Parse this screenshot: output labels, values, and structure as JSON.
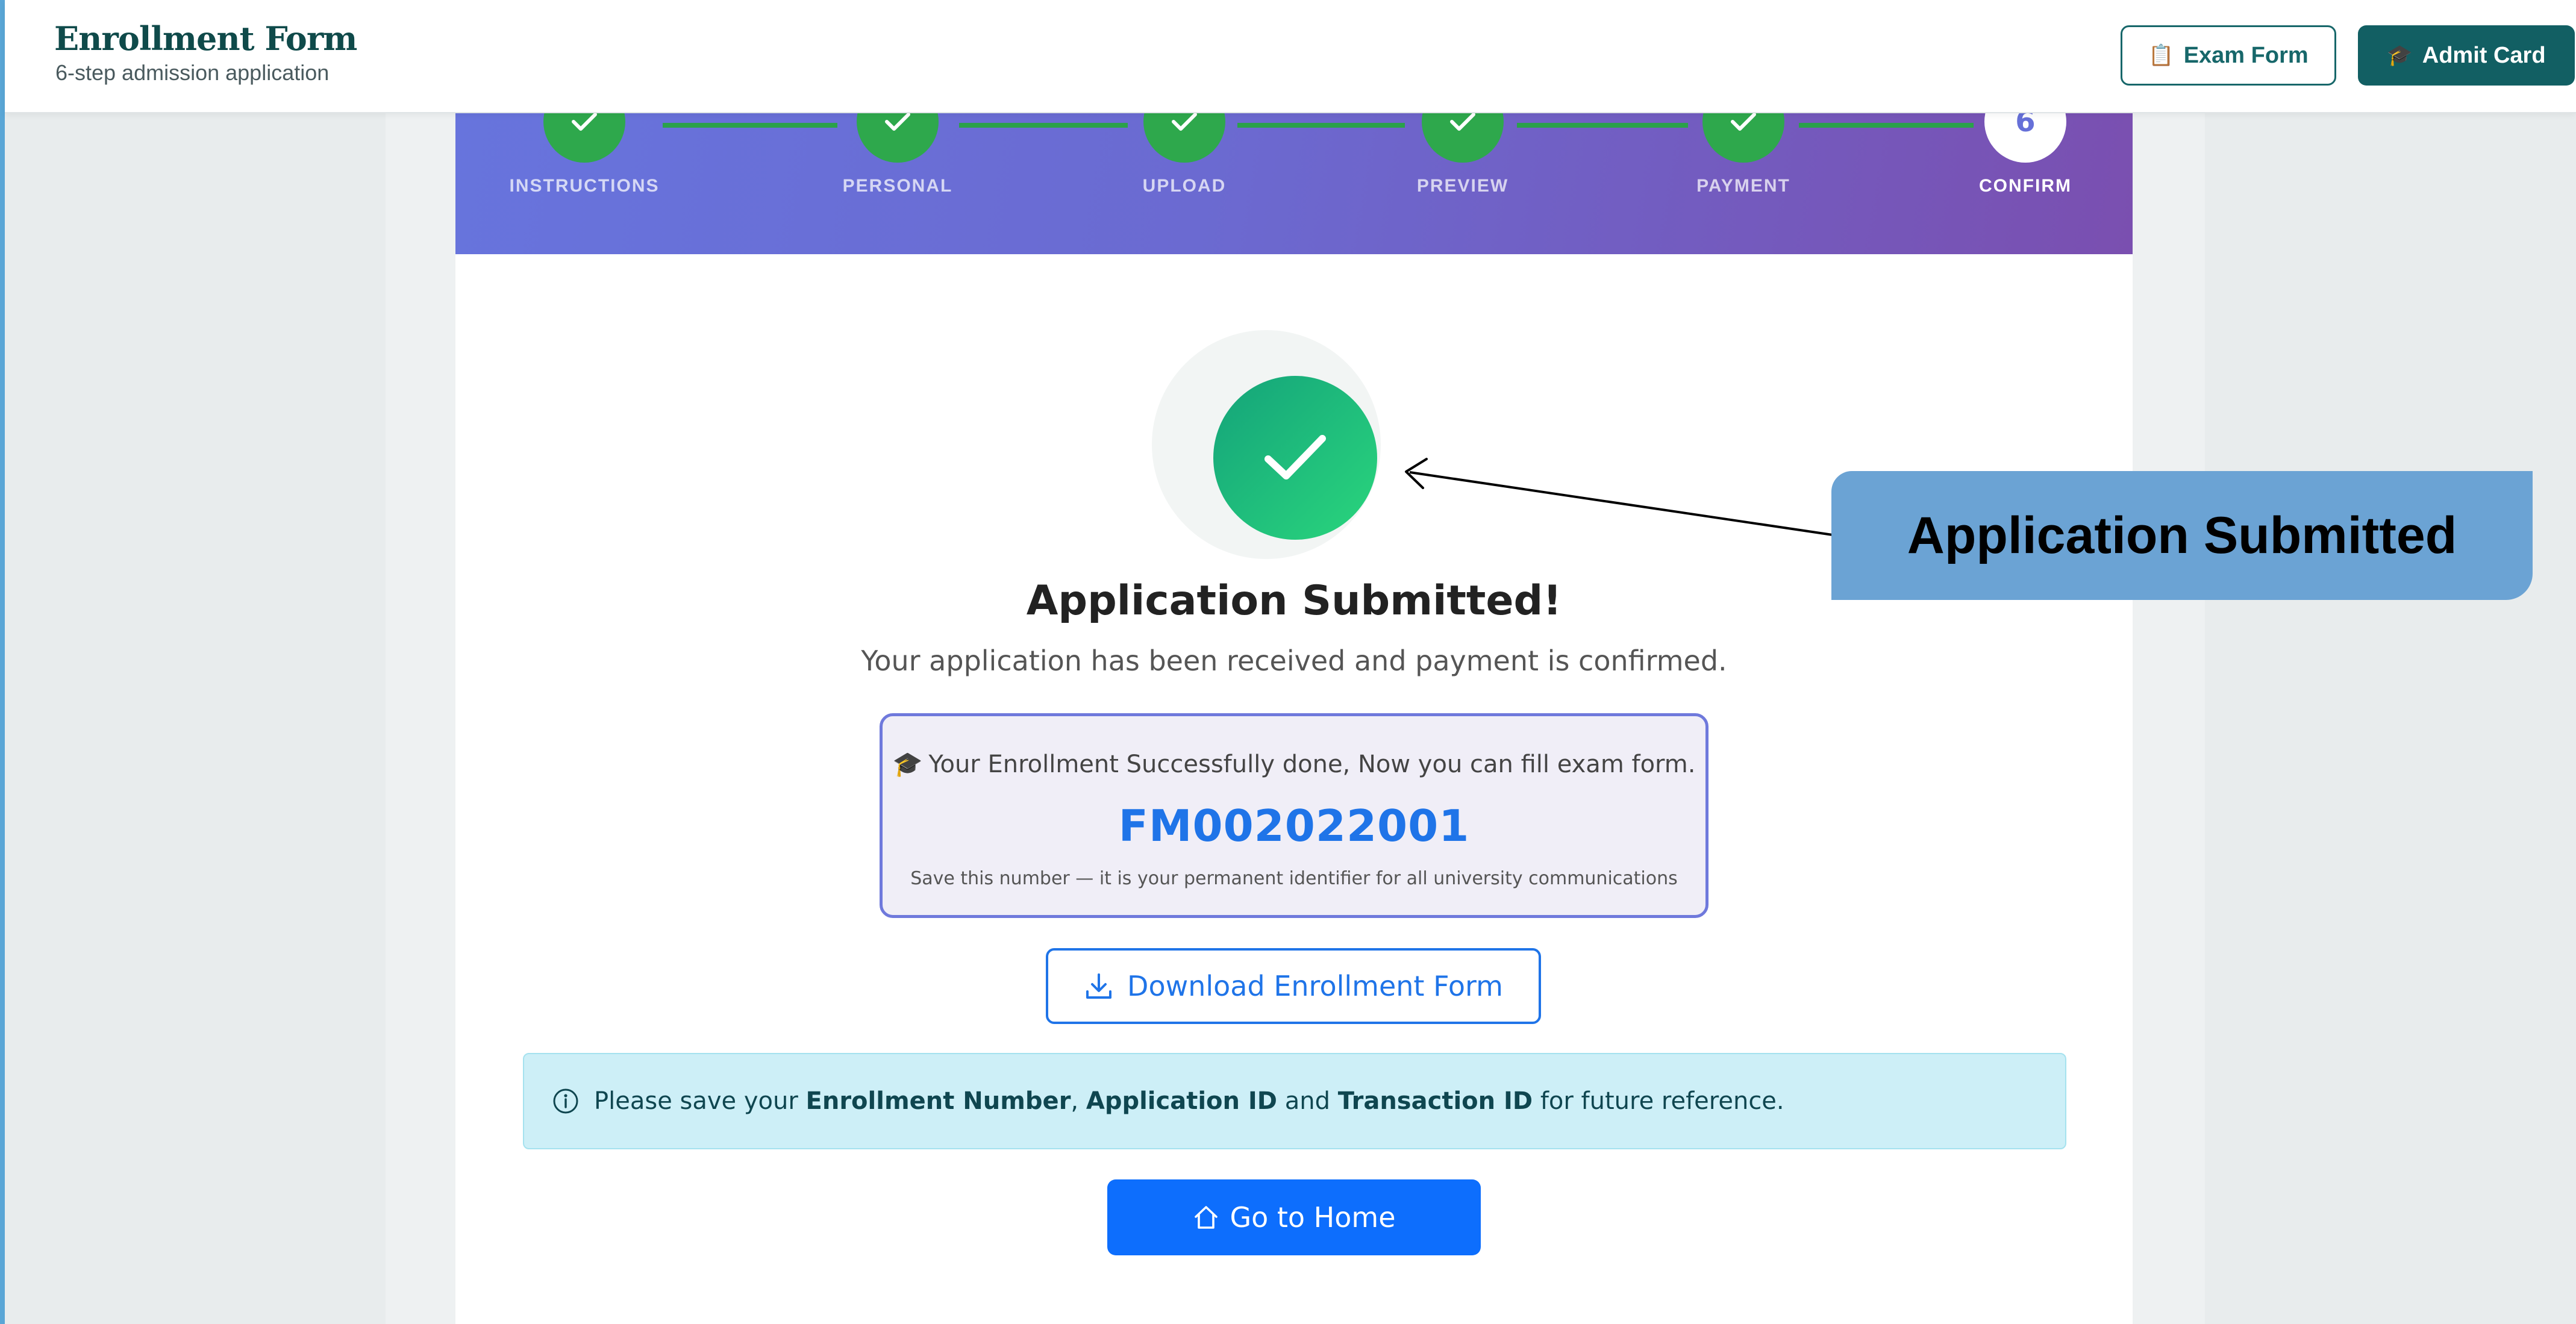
{
  "header": {
    "title": "Enrollment Form",
    "subtitle": "6-step admission application",
    "exam_form_label": "Exam Form",
    "exam_form_icon": "clipboard-icon",
    "admit_card_label": "Admit Card",
    "admit_card_icon": "graduation-cap-icon"
  },
  "stepper": {
    "steps": [
      {
        "label": "INSTRUCTIONS",
        "status": "completed"
      },
      {
        "label": "PERSONAL",
        "status": "completed"
      },
      {
        "label": "UPLOAD",
        "status": "completed"
      },
      {
        "label": "PREVIEW",
        "status": "completed"
      },
      {
        "label": "PAYMENT",
        "status": "completed"
      },
      {
        "label": "CONFIRM",
        "status": "active",
        "number": "6"
      }
    ]
  },
  "confirmation": {
    "headline": "Application Submitted!",
    "subline": "Your application has been received and payment is confirmed.",
    "enrollment_message": "Your Enrollment Successfully done, Now you can fill exam form.",
    "enrollment_number": "FM002022001",
    "enrollment_note": "Save this number — it is your permanent identifier for all university communications",
    "download_label": "Download Enrollment Form",
    "info_prefix": "Please save your",
    "info_item1": "Enrollment Number",
    "info_sep1": ",",
    "info_item2": "Application ID",
    "info_and": "and",
    "info_item3": "Transaction ID",
    "info_suffix": "for future reference.",
    "home_label": "Go to Home"
  },
  "callout": {
    "text": "Application Submitted"
  },
  "colors": {
    "brand_teal": "#125f63",
    "step_complete": "#2ea84c",
    "primary_blue": "#0d6efd",
    "success_green": "#2ad67d",
    "callout_blue": "#6ba3d4"
  }
}
